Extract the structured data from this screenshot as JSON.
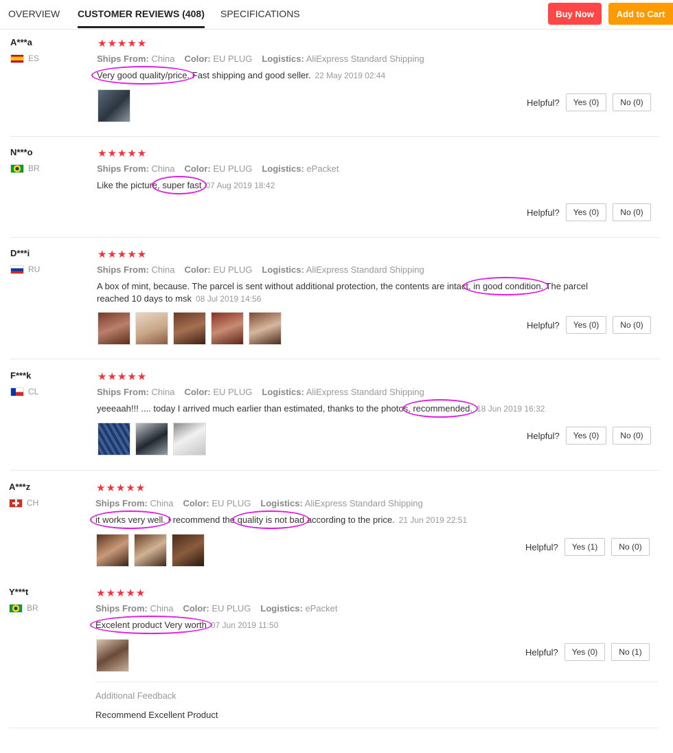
{
  "tabs": [
    {
      "label": "OVERVIEW"
    },
    {
      "label": "CUSTOMER REVIEWS (408)"
    },
    {
      "label": "SPECIFICATIONS"
    }
  ],
  "actions": {
    "buy_now": "Buy Now",
    "add_to_cart": "Add to Cart"
  },
  "labels": {
    "ships_from": "Ships From:",
    "color": "Color:",
    "logistics": "Logistics:",
    "helpful": "Helpful?",
    "stars": "★★★★★"
  },
  "reviews": [
    {
      "user": "A***a",
      "country": "ES",
      "flag": "es",
      "ships_from": "China",
      "color": "EU PLUG",
      "logistics": "AliExpress Standard Shipping",
      "text_parts": [
        "Very good quality/price.",
        " Fast shipping and good seller."
      ],
      "date": "22 May 2019 02:44",
      "yes": "Yes (0)",
      "no": "No (0)",
      "photos": 1
    },
    {
      "user": "N***o",
      "country": "BR",
      "flag": "br",
      "ships_from": "China",
      "color": "EU PLUG",
      "logistics": "ePacket",
      "text_parts": [
        "Like the picture",
        ", super fast"
      ],
      "date": "07 Aug 2019 18:42",
      "yes": "Yes (0)",
      "no": "No (0)",
      "photos": 0
    },
    {
      "user": "D***i",
      "country": "RU",
      "flag": "ru",
      "ships_from": "China",
      "color": "EU PLUG",
      "logistics": "AliExpress Standard Shipping",
      "text_parts": [
        "A box of mint, because. The parcel is sent without additional protection, the contents are intact",
        ", in good condition.",
        " The parcel reached 10 days to msk"
      ],
      "date": "08 Jul 2019 14:56",
      "yes": "Yes (0)",
      "no": "No (0)",
      "photos": 5
    },
    {
      "user": "F***k",
      "country": "CL",
      "flag": "cl",
      "ships_from": "China",
      "color": "EU PLUG",
      "logistics": "AliExpress Standard Shipping",
      "text_parts": [
        "yeeeaah!!! .... today I arrived much earlier than estimated, thanks to the photos",
        ", recommended."
      ],
      "date": "18 Jun 2019 16:32",
      "yes": "Yes (0)",
      "no": "No (0)",
      "photos": 3
    },
    {
      "user": "A***z",
      "country": "CH",
      "flag": "ch",
      "ships_from": "China",
      "color": "EU PLUG",
      "logistics": "AliExpress Standard Shipping",
      "text_parts": [
        "it works very well.",
        " I recommend the ",
        "quality is not bad",
        " according to the price."
      ],
      "date": "21 Jun 2019 22:51",
      "yes": "Yes (1)",
      "no": "No (0)",
      "photos": 3
    },
    {
      "user": "Y***t",
      "country": "BR",
      "flag": "br",
      "ships_from": "China",
      "color": "EU PLUG",
      "logistics": "ePacket",
      "text_parts": [
        "Excelent product Very worth"
      ],
      "date": "07 Jun 2019 11:50",
      "yes": "Yes (0)",
      "no": "No (1)",
      "photos": 1
    }
  ],
  "additional_feedback": {
    "title": "Additional Feedback",
    "text": "Recommend Excellent Product"
  },
  "colors": {
    "accent_red": "#ff4747",
    "accent_orange": "#ff9a00",
    "star": "#f5313a",
    "highlight": "#e01ee0"
  }
}
